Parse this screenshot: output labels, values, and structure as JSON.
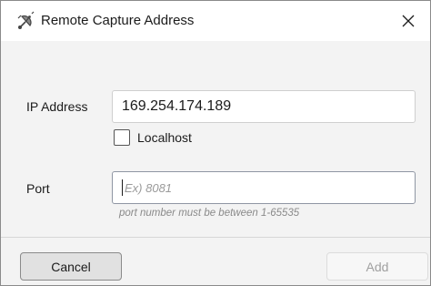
{
  "window": {
    "title": "Remote Capture Address",
    "app_icon": "satellite-dish-icon",
    "close_icon": "close-icon"
  },
  "form": {
    "ip_label": "IP Address",
    "ip_value": "169.254.174.189",
    "localhost_label": "Localhost",
    "localhost_checked": false,
    "port_label": "Port",
    "port_value": "",
    "port_placeholder": "Ex) 8081",
    "port_hint": "port number must be between 1-65535"
  },
  "buttons": {
    "cancel_label": "Cancel",
    "add_label": "Add",
    "add_enabled": false
  },
  "colors": {
    "background": "#f3f3f3",
    "titlebar": "#ffffff",
    "disabled_text": "#a0a0a0"
  }
}
